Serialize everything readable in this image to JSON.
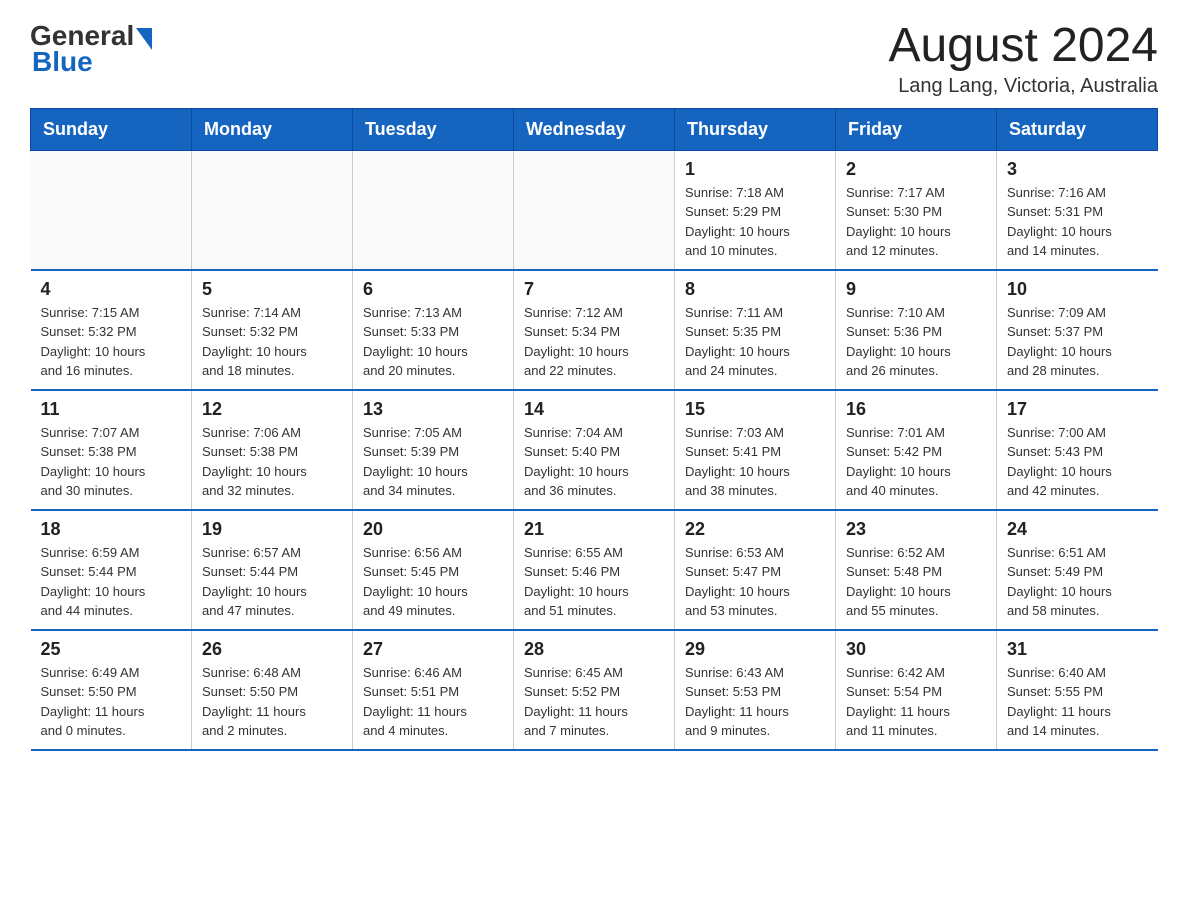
{
  "header": {
    "logo_general": "General",
    "logo_blue": "Blue",
    "title": "August 2024",
    "subtitle": "Lang Lang, Victoria, Australia"
  },
  "days_of_week": [
    "Sunday",
    "Monday",
    "Tuesday",
    "Wednesday",
    "Thursday",
    "Friday",
    "Saturday"
  ],
  "weeks": [
    {
      "days": [
        {
          "number": "",
          "info": ""
        },
        {
          "number": "",
          "info": ""
        },
        {
          "number": "",
          "info": ""
        },
        {
          "number": "",
          "info": ""
        },
        {
          "number": "1",
          "info": "Sunrise: 7:18 AM\nSunset: 5:29 PM\nDaylight: 10 hours\nand 10 minutes."
        },
        {
          "number": "2",
          "info": "Sunrise: 7:17 AM\nSunset: 5:30 PM\nDaylight: 10 hours\nand 12 minutes."
        },
        {
          "number": "3",
          "info": "Sunrise: 7:16 AM\nSunset: 5:31 PM\nDaylight: 10 hours\nand 14 minutes."
        }
      ]
    },
    {
      "days": [
        {
          "number": "4",
          "info": "Sunrise: 7:15 AM\nSunset: 5:32 PM\nDaylight: 10 hours\nand 16 minutes."
        },
        {
          "number": "5",
          "info": "Sunrise: 7:14 AM\nSunset: 5:32 PM\nDaylight: 10 hours\nand 18 minutes."
        },
        {
          "number": "6",
          "info": "Sunrise: 7:13 AM\nSunset: 5:33 PM\nDaylight: 10 hours\nand 20 minutes."
        },
        {
          "number": "7",
          "info": "Sunrise: 7:12 AM\nSunset: 5:34 PM\nDaylight: 10 hours\nand 22 minutes."
        },
        {
          "number": "8",
          "info": "Sunrise: 7:11 AM\nSunset: 5:35 PM\nDaylight: 10 hours\nand 24 minutes."
        },
        {
          "number": "9",
          "info": "Sunrise: 7:10 AM\nSunset: 5:36 PM\nDaylight: 10 hours\nand 26 minutes."
        },
        {
          "number": "10",
          "info": "Sunrise: 7:09 AM\nSunset: 5:37 PM\nDaylight: 10 hours\nand 28 minutes."
        }
      ]
    },
    {
      "days": [
        {
          "number": "11",
          "info": "Sunrise: 7:07 AM\nSunset: 5:38 PM\nDaylight: 10 hours\nand 30 minutes."
        },
        {
          "number": "12",
          "info": "Sunrise: 7:06 AM\nSunset: 5:38 PM\nDaylight: 10 hours\nand 32 minutes."
        },
        {
          "number": "13",
          "info": "Sunrise: 7:05 AM\nSunset: 5:39 PM\nDaylight: 10 hours\nand 34 minutes."
        },
        {
          "number": "14",
          "info": "Sunrise: 7:04 AM\nSunset: 5:40 PM\nDaylight: 10 hours\nand 36 minutes."
        },
        {
          "number": "15",
          "info": "Sunrise: 7:03 AM\nSunset: 5:41 PM\nDaylight: 10 hours\nand 38 minutes."
        },
        {
          "number": "16",
          "info": "Sunrise: 7:01 AM\nSunset: 5:42 PM\nDaylight: 10 hours\nand 40 minutes."
        },
        {
          "number": "17",
          "info": "Sunrise: 7:00 AM\nSunset: 5:43 PM\nDaylight: 10 hours\nand 42 minutes."
        }
      ]
    },
    {
      "days": [
        {
          "number": "18",
          "info": "Sunrise: 6:59 AM\nSunset: 5:44 PM\nDaylight: 10 hours\nand 44 minutes."
        },
        {
          "number": "19",
          "info": "Sunrise: 6:57 AM\nSunset: 5:44 PM\nDaylight: 10 hours\nand 47 minutes."
        },
        {
          "number": "20",
          "info": "Sunrise: 6:56 AM\nSunset: 5:45 PM\nDaylight: 10 hours\nand 49 minutes."
        },
        {
          "number": "21",
          "info": "Sunrise: 6:55 AM\nSunset: 5:46 PM\nDaylight: 10 hours\nand 51 minutes."
        },
        {
          "number": "22",
          "info": "Sunrise: 6:53 AM\nSunset: 5:47 PM\nDaylight: 10 hours\nand 53 minutes."
        },
        {
          "number": "23",
          "info": "Sunrise: 6:52 AM\nSunset: 5:48 PM\nDaylight: 10 hours\nand 55 minutes."
        },
        {
          "number": "24",
          "info": "Sunrise: 6:51 AM\nSunset: 5:49 PM\nDaylight: 10 hours\nand 58 minutes."
        }
      ]
    },
    {
      "days": [
        {
          "number": "25",
          "info": "Sunrise: 6:49 AM\nSunset: 5:50 PM\nDaylight: 11 hours\nand 0 minutes."
        },
        {
          "number": "26",
          "info": "Sunrise: 6:48 AM\nSunset: 5:50 PM\nDaylight: 11 hours\nand 2 minutes."
        },
        {
          "number": "27",
          "info": "Sunrise: 6:46 AM\nSunset: 5:51 PM\nDaylight: 11 hours\nand 4 minutes."
        },
        {
          "number": "28",
          "info": "Sunrise: 6:45 AM\nSunset: 5:52 PM\nDaylight: 11 hours\nand 7 minutes."
        },
        {
          "number": "29",
          "info": "Sunrise: 6:43 AM\nSunset: 5:53 PM\nDaylight: 11 hours\nand 9 minutes."
        },
        {
          "number": "30",
          "info": "Sunrise: 6:42 AM\nSunset: 5:54 PM\nDaylight: 11 hours\nand 11 minutes."
        },
        {
          "number": "31",
          "info": "Sunrise: 6:40 AM\nSunset: 5:55 PM\nDaylight: 11 hours\nand 14 minutes."
        }
      ]
    }
  ]
}
